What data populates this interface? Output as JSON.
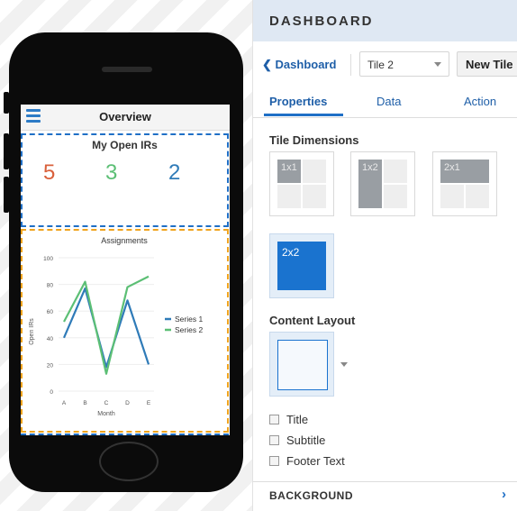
{
  "phone_app": {
    "title": "Overview",
    "tile1": {
      "title": "My Open IRs",
      "metrics": [
        {
          "value": "5",
          "color": "#d9603b"
        },
        {
          "value": "3",
          "color": "#5cbf75"
        },
        {
          "value": "2",
          "color": "#2f7bb8"
        }
      ]
    }
  },
  "chart_data": {
    "type": "line",
    "title": "Assignments",
    "xlabel": "Month",
    "ylabel": "Open IRs",
    "categories": [
      "A",
      "B",
      "C",
      "D",
      "E"
    ],
    "yticks": [
      "0",
      "20",
      "40",
      "60",
      "80",
      "100"
    ],
    "ylim": [
      0,
      100
    ],
    "legend_position": "right",
    "series": [
      {
        "name": "Series 1",
        "color": "#2f7bb8",
        "values": [
          40,
          77,
          18,
          68,
          20
        ]
      },
      {
        "name": "Series 2",
        "color": "#5cbf75",
        "values": [
          52,
          82,
          13,
          78,
          86
        ]
      }
    ]
  },
  "panel": {
    "title": "DASHBOARD",
    "back_label": "Dashboard",
    "back_icon": "chevron-left",
    "tile_select_value": "Tile 2",
    "new_tile_label": "New Tile",
    "tabs": [
      "Properties",
      "Data",
      "Action"
    ],
    "active_tab": "Properties",
    "tile_dimensions_label": "Tile Dimensions",
    "dimension_options": [
      {
        "label": "1x1",
        "selected": false
      },
      {
        "label": "1x2",
        "selected": false
      },
      {
        "label": "2x1",
        "selected": false
      },
      {
        "label": "2x2",
        "selected": true
      }
    ],
    "content_layout_label": "Content Layout",
    "checkboxes": [
      {
        "label": "Title",
        "checked": false
      },
      {
        "label": "Subtitle",
        "checked": false
      },
      {
        "label": "Footer Text",
        "checked": false
      }
    ],
    "background_label": "BACKGROUND",
    "accent_color": "#1a73cf"
  }
}
